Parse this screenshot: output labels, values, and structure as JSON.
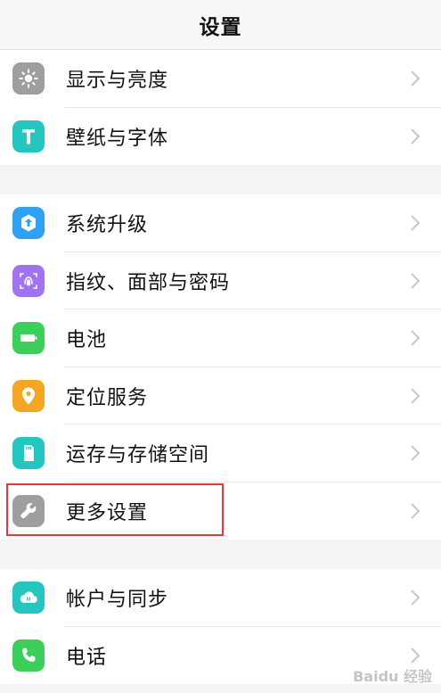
{
  "header": {
    "title": "设置"
  },
  "groups": [
    {
      "items": [
        {
          "label": "显示与亮度",
          "icon": "brightness-icon",
          "color": "#9e9e9e"
        },
        {
          "label": "壁纸与字体",
          "icon": "font-t-icon",
          "color": "#26c6c0"
        }
      ]
    },
    {
      "items": [
        {
          "label": "系统升级",
          "icon": "system-update-icon",
          "color": "#2ea1f2"
        },
        {
          "label": "指纹、面部与密码",
          "icon": "fingerprint-icon",
          "color": "#a074f0"
        },
        {
          "label": "电池",
          "icon": "battery-icon",
          "color": "#3ccf5c"
        },
        {
          "label": "定位服务",
          "icon": "location-pin-icon",
          "color": "#f5a623"
        },
        {
          "label": "运存与存储空间",
          "icon": "storage-card-icon",
          "color": "#26c6c0"
        },
        {
          "label": "更多设置",
          "icon": "wrench-icon",
          "color": "#9e9e9e"
        }
      ]
    },
    {
      "items": [
        {
          "label": "帐户与同步",
          "icon": "cloud-sync-icon",
          "color": "#26c6c0"
        },
        {
          "label": "电话",
          "icon": "phone-icon",
          "color": "#3ccf5c"
        }
      ]
    }
  ],
  "watermark": "Baidu 经验",
  "colors": {
    "highlight": "#e53935",
    "chevron": "#c7c7c7",
    "background": "#f4f4f4"
  }
}
